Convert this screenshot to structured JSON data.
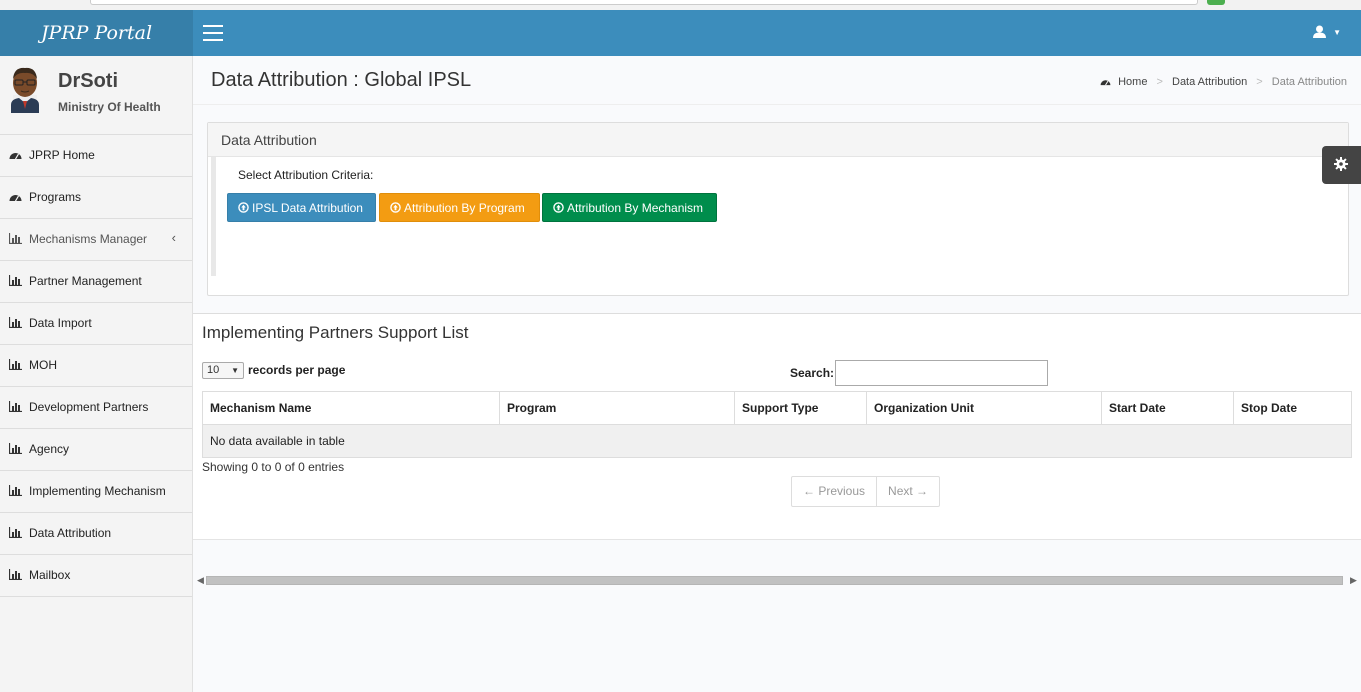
{
  "app": {
    "logo_text": "JPRP Portal"
  },
  "user": {
    "name": "DrSoti",
    "organization": "Ministry Of Health"
  },
  "sidebar": {
    "items": [
      {
        "label": "JPRP Home",
        "icon": "dashboard-icon"
      },
      {
        "label": "Programs",
        "icon": "dashboard-icon"
      },
      {
        "label": "Mechanisms Manager",
        "icon": "bar-chart-icon",
        "has_children": true
      },
      {
        "label": "Partner Management",
        "icon": "bar-chart-icon"
      },
      {
        "label": "Data Import",
        "icon": "bar-chart-icon"
      },
      {
        "label": "MOH",
        "icon": "bar-chart-icon"
      },
      {
        "label": "Development Partners",
        "icon": "bar-chart-icon"
      },
      {
        "label": "Agency",
        "icon": "bar-chart-icon"
      },
      {
        "label": "Implementing Mechanism",
        "icon": "bar-chart-icon"
      },
      {
        "label": "Data Attribution",
        "icon": "bar-chart-icon"
      },
      {
        "label": "Mailbox",
        "icon": "bar-chart-icon"
      }
    ],
    "chevron": "‹"
  },
  "header": {
    "page_title": "Data Attribution : Global IPSL",
    "breadcrumb": {
      "home": "Home",
      "section": "Data Attribution",
      "current": "Data Attribution",
      "separator": ">"
    }
  },
  "attribution_box": {
    "title": "Data Attribution",
    "criteria_label": "Select Attribution Criteria:",
    "buttons": {
      "ipsl": "IPSL Data Attribution",
      "program": "Attribution By Program",
      "mechanism": "Attribution By Mechanism"
    }
  },
  "support_list": {
    "title": "Implementing Partners Support List",
    "page_length": "10",
    "page_length_suffix": "records per page",
    "search_label": "Search:",
    "columns": [
      "Mechanism Name",
      "Program",
      "Support Type",
      "Organization Unit",
      "Start Date",
      "Stop Date"
    ],
    "empty_message": "No data available in table",
    "info": "Showing 0 to 0 of 0 entries",
    "pager": {
      "previous": "← Previous",
      "next": "Next →"
    }
  },
  "colors": {
    "navbar": "#3c8dbc",
    "logo_bg": "#367fa9",
    "btn_blue": "#3c8dbc",
    "btn_orange": "#f39c12",
    "btn_green": "#008d4c"
  }
}
